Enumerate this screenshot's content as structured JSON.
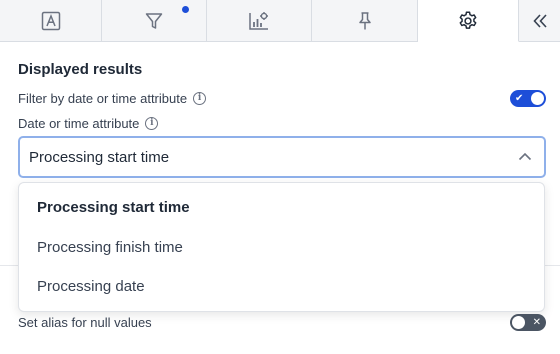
{
  "tabs": [
    {
      "icon": "text-format-icon"
    },
    {
      "icon": "filter-icon",
      "has_indicator": true
    },
    {
      "icon": "chart-settings-icon"
    },
    {
      "icon": "pin-icon"
    },
    {
      "icon": "gear-icon",
      "active": true
    },
    {
      "icon": "collapse-chevrons-icon"
    }
  ],
  "section": {
    "title": "Displayed results",
    "filter_by_date": {
      "label": "Filter by date or time attribute",
      "enabled": true
    },
    "date_attribute": {
      "label": "Date or time attribute",
      "selected": "Processing start time",
      "options": [
        "Processing start time",
        "Processing finish time",
        "Processing date"
      ]
    },
    "null_alias": {
      "label": "Set alias for null values",
      "enabled": false
    }
  },
  "colors": {
    "accent": "#1d4ed8",
    "toggle_off": "#4b5563",
    "select_border": "#8fb0ea"
  }
}
